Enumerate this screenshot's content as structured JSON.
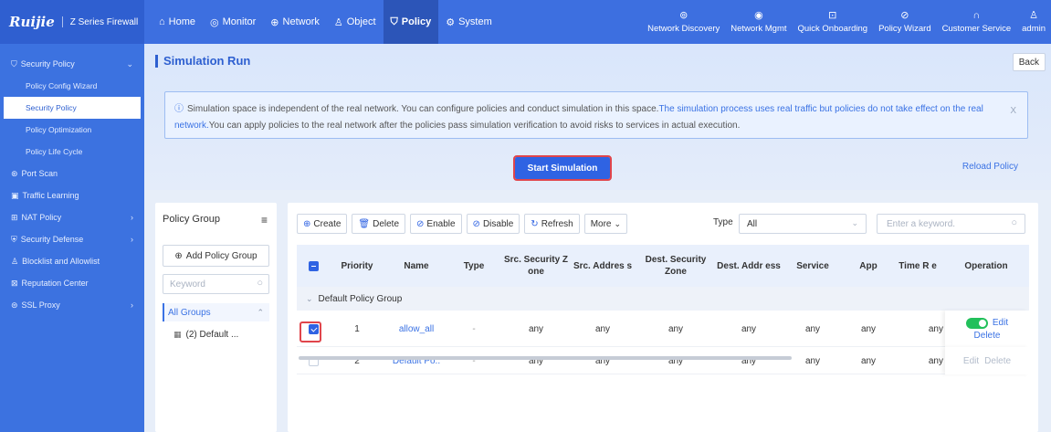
{
  "brand": {
    "logo": "Ruijie",
    "series": "Z Series Firewall"
  },
  "nav": {
    "items": [
      {
        "icon": "⌂",
        "label": "Home"
      },
      {
        "icon": "◎",
        "label": "Monitor"
      },
      {
        "icon": "⊕",
        "label": "Network"
      },
      {
        "icon": "♙",
        "label": "Object"
      },
      {
        "icon": "⛉",
        "label": "Policy"
      },
      {
        "icon": "⚙",
        "label": "System"
      }
    ],
    "right": [
      {
        "icon": "⊚",
        "label": "Network Discovery"
      },
      {
        "icon": "◉",
        "label": "Network Mgmt"
      },
      {
        "icon": "⊡",
        "label": "Quick Onboarding"
      },
      {
        "icon": "⊘",
        "label": "Policy Wizard"
      },
      {
        "icon": "∩",
        "label": "Customer Service"
      },
      {
        "icon": "♙",
        "label": "admin"
      }
    ]
  },
  "sidebar": {
    "security_policy": "Security Policy",
    "sub": [
      "Policy Config Wizard",
      "Security Policy",
      "Policy Optimization",
      "Policy Life Cycle"
    ],
    "groups": [
      "Port Scan",
      "Traffic Learning",
      "NAT Policy",
      "Security Defense",
      "Blocklist and Allowlist",
      "Reputation Center",
      "SSL Proxy"
    ]
  },
  "page": {
    "title": "Simulation Run",
    "back": "Back",
    "notice_part1": "Simulation space is independent of the real network. You can configure policies and conduct simulation in this space.",
    "notice_part2": "The simulation process uses real traffic but policies do not take effect on the real network.",
    "notice_part3": "You can apply policies to the real network after the policies pass simulation verification to avoid risks to services in actual execution.",
    "notice_close": "X",
    "start_simulation": "Start Simulation",
    "reload_policy": "Reload Policy"
  },
  "policy_group": {
    "title": "Policy Group",
    "add": "Add Policy Group",
    "search_placeholder": "Keyword",
    "all_groups": "All Groups",
    "child": "(2) Default ..."
  },
  "toolbar": {
    "create": "Create",
    "delete": "Delete",
    "enable": "Enable",
    "disable": "Disable",
    "refresh": "Refresh",
    "more": "More",
    "type_label": "Type",
    "type_value": "All",
    "keyword_placeholder": "Enter a keyword."
  },
  "table": {
    "headers": {
      "priority": "Priority",
      "name": "Name",
      "type": "Type",
      "src_zone": "Src. Security Z one",
      "src_addr": "Src. Addres s",
      "dst_zone": "Dest. Security Zone",
      "dst_addr": "Dest. Addr ess",
      "service": "Service",
      "app": "App",
      "time": "Time R e",
      "operation": "Operation"
    },
    "group_row": "Default Policy Group",
    "rows": [
      {
        "priority": "1",
        "name": "allow_all",
        "type": "-",
        "src_zone": "any",
        "src_addr": "any",
        "dst_zone": "any",
        "dst_addr": "any",
        "service": "any",
        "app": "any",
        "time": "any",
        "edit": "Edit",
        "delete": "Delete"
      },
      {
        "priority": "2",
        "name": "Default Po..",
        "type": "-",
        "src_zone": "any",
        "src_addr": "any",
        "dst_zone": "any",
        "dst_addr": "any",
        "service": "any",
        "app": "any",
        "time": "any",
        "edit": "Edit",
        "delete": "Delete"
      }
    ]
  }
}
